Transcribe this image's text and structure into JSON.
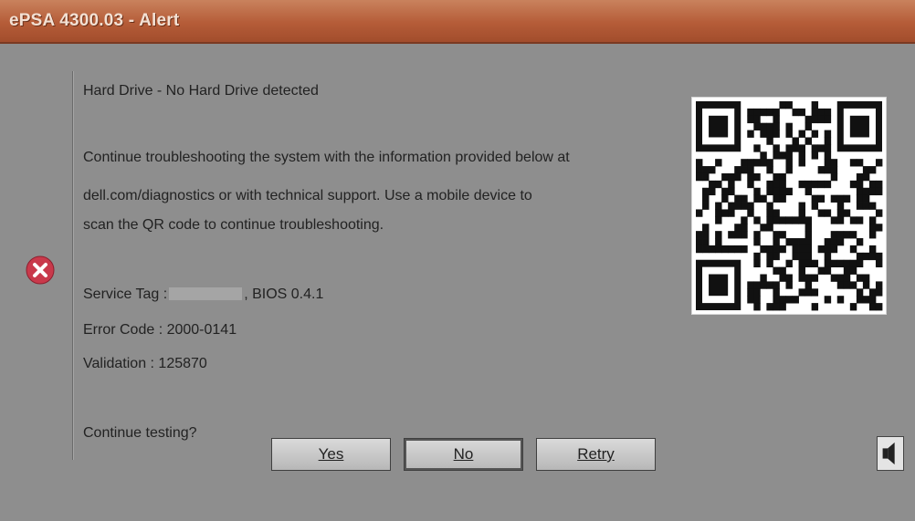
{
  "window": {
    "title": "ePSA 4300.03 - Alert"
  },
  "message": {
    "heading": "Hard Drive - No Hard Drive detected",
    "paragraph_lines": [
      "Continue troubleshooting the system with the information provided below at",
      "dell.com/diagnostics or with technical support.  Use a mobile device to",
      "scan the QR code to continue troubleshooting."
    ],
    "service_tag_label": "Service Tag :",
    "bios": ", BIOS 0.4.1",
    "error_code": "Error Code : 2000-0141",
    "validation": "Validation : 125870",
    "prompt": "Continue testing?"
  },
  "buttons": {
    "yes": "Yes",
    "no": "No",
    "retry": "Retry"
  },
  "icons": {
    "error": "error-x-icon",
    "qr": "qr-code",
    "speaker": "speaker-icon"
  },
  "colors": {
    "titlebar": "#b55c38",
    "background": "#8e8e8e",
    "error": "#c9394b"
  }
}
